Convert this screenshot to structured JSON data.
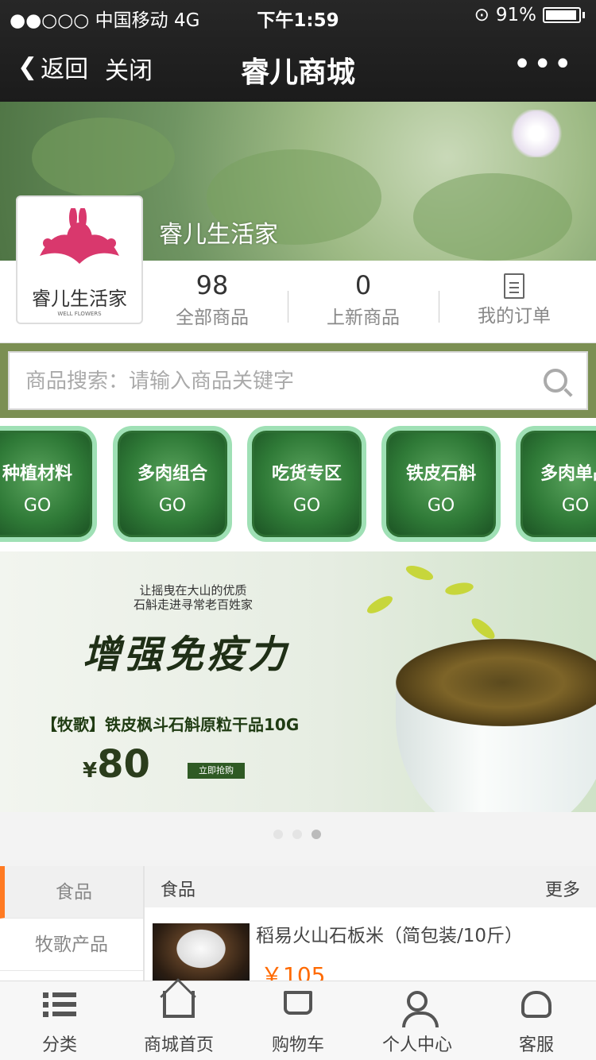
{
  "status": {
    "carrier": "●●○○○ 中国移动  4G",
    "time": "下午1:59",
    "battery": "91%"
  },
  "nav": {
    "back": "返回",
    "close": "关闭",
    "title": "睿儿商城",
    "more": "•••"
  },
  "shop": {
    "name": "睿儿生活家",
    "logo_cn": "睿儿生活家",
    "logo_en": "WELL FLOWERS"
  },
  "stats": [
    {
      "value": "98",
      "label": "全部商品"
    },
    {
      "value": "0",
      "label": "上新商品"
    },
    {
      "label": "我的订单"
    }
  ],
  "search": {
    "placeholder": "商品搜索：请输入商品关键字"
  },
  "categories": [
    {
      "name": "种植材料",
      "go": "GO"
    },
    {
      "name": "多肉组合",
      "go": "GO"
    },
    {
      "name": "吃货专区",
      "go": "GO"
    },
    {
      "name": "铁皮石斛",
      "go": "GO"
    },
    {
      "name": "多肉单品",
      "go": "GO"
    }
  ],
  "promo": {
    "tagline": "让摇曳在大山的优质\n石斛走进寻常老百姓家",
    "slogan": "增强免疫力",
    "product": "【牧歌】铁皮枫斗石斛原粒干品10G",
    "price": "80",
    "currency": "¥",
    "buy": "立即抢购"
  },
  "side": {
    "items": [
      "食品",
      "牧歌产品"
    ]
  },
  "list": {
    "title": "食品",
    "more": "更多",
    "item": {
      "name": "稻易火山石板米（简包装/10斤）",
      "price": "￥105"
    }
  },
  "tabs": [
    {
      "label": "分类",
      "icon": "list-icon"
    },
    {
      "label": "商城首页",
      "icon": "home-icon"
    },
    {
      "label": "购物车",
      "icon": "cart-icon"
    },
    {
      "label": "个人中心",
      "icon": "user-icon"
    },
    {
      "label": "客服",
      "icon": "headset-icon"
    }
  ],
  "colors": {
    "accent": "#ff6a00",
    "nav_bg": "#1f1f1f",
    "search_band": "#7b8f53",
    "category_green": "#2f7a37"
  }
}
